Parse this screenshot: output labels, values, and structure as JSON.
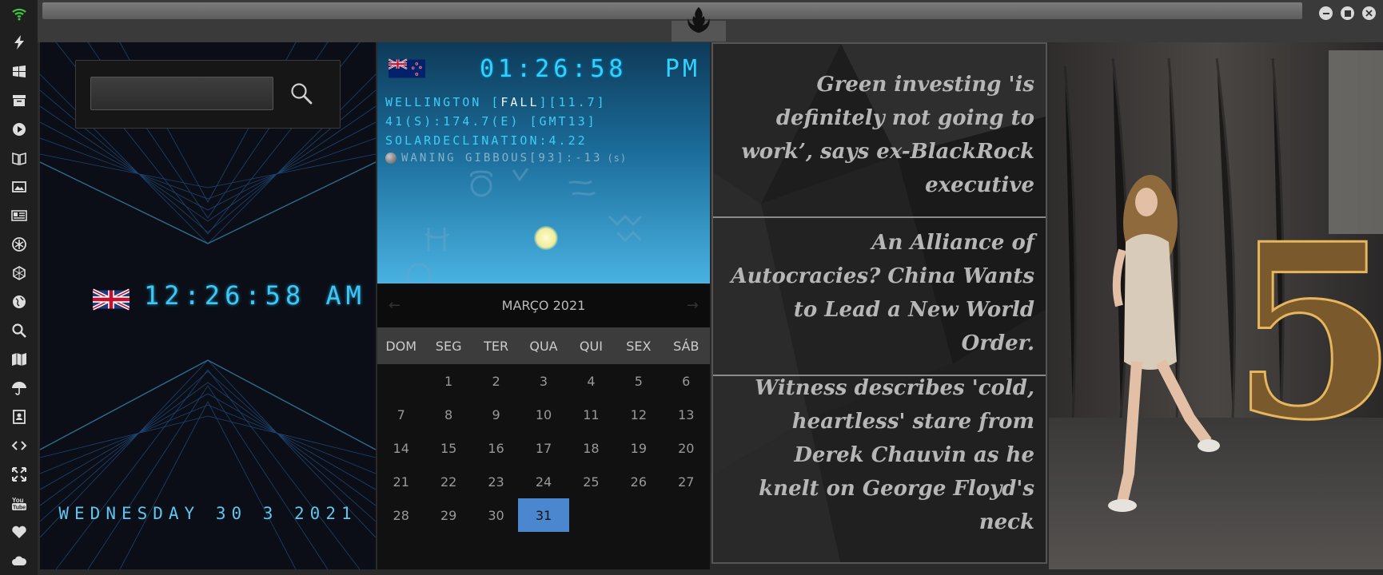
{
  "sidebar": {
    "icons": [
      "wifi-icon",
      "bolt-icon",
      "windows-icon",
      "archive-icon",
      "play-icon",
      "book-icon",
      "image-icon",
      "news-icon",
      "asterisk-icon",
      "hexagon-icon",
      "globe-icon",
      "search-icon",
      "map-icon",
      "umbrella-icon",
      "contact-icon",
      "code-icon",
      "expand-icon",
      "youtube-icon",
      "heart-icon",
      "cloud-icon"
    ],
    "accent": "#3ec93e"
  },
  "window": {
    "logo": "rebel-alliance-logo"
  },
  "search": {
    "value": "",
    "placeholder": ""
  },
  "uk_clock": {
    "time": "12:26:58 AM",
    "date": "WEDNESDAY 30 3 2021",
    "color": "#3fc7f3"
  },
  "nz_weather": {
    "time": "01:26:58",
    "ampm": "PM",
    "city_prefix": "WELLINGTON [",
    "season": "FALL",
    "city_suffix": "][11.7]",
    "coords": "41(S):174.7(E) [GMT13]",
    "declination": "SOLARDECLINATION:4.22",
    "moon": "WANING GIBBOUS[93]:-13",
    "moon_unit": "(s)"
  },
  "calendar": {
    "month": "MARÇO 2021",
    "weekdays": [
      "DOM",
      "SEG",
      "TER",
      "QUA",
      "QUI",
      "SEX",
      "SÁB"
    ],
    "days": [
      "",
      "1",
      "2",
      "3",
      "4",
      "5",
      "6",
      "7",
      "8",
      "9",
      "10",
      "11",
      "12",
      "13",
      "14",
      "15",
      "16",
      "17",
      "18",
      "19",
      "20",
      "21",
      "22",
      "23",
      "24",
      "25",
      "26",
      "27",
      "28",
      "29",
      "30",
      "31",
      "",
      "",
      ""
    ],
    "selected": "31",
    "selected_color": "#4b87cf"
  },
  "news": {
    "items": [
      "Green investing 'is definitely not going to work’, says ex-BlackRock executive",
      "An Alliance of Autocracies? China Wants to Lead a New World Order.",
      "Witness describes 'cold, heartless' stare from Derek Chauvin as he knelt on George Floyd's neck"
    ]
  },
  "photo": {
    "number": "5"
  }
}
